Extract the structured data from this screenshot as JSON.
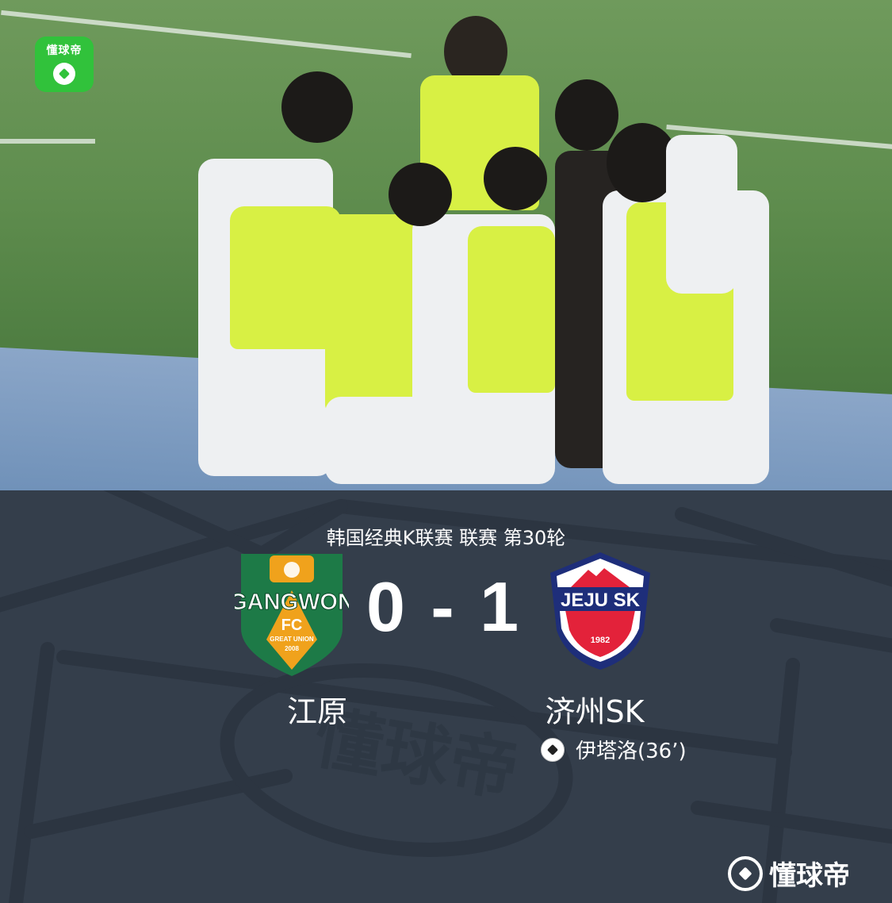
{
  "app": {
    "badge_label": "懂球帝",
    "watermark_label": "懂球帝",
    "brand_color": "#31c23b"
  },
  "match": {
    "competition": "韩国经典K联赛 联赛 第30轮",
    "score": "0 - 1",
    "home": {
      "name": "江原",
      "crest_text": "GANGWON",
      "crest_sub": "FC",
      "crest_motto": "GREAT UNION",
      "crest_year": "2008",
      "crest_colors": [
        "#1d7a47",
        "#f0a21c"
      ]
    },
    "away": {
      "name": "济州SK",
      "crest_text": "JEJU SK",
      "crest_year": "1982",
      "crest_colors": [
        "#1e2e7a",
        "#e3223a"
      ]
    },
    "goals": [
      {
        "team": "away",
        "scorer": "伊塔洛(36’)",
        "icon": "football-icon"
      }
    ]
  },
  "background_watermark": "懂球帝"
}
